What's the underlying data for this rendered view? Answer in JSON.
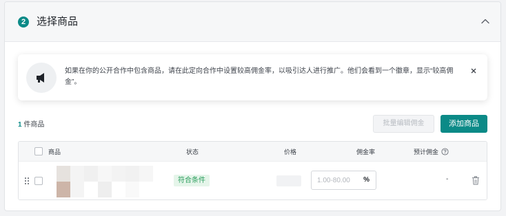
{
  "section": {
    "step_number": "2",
    "title": "选择商品",
    "collapse_icon": "chevron-up-icon"
  },
  "notice": {
    "icon": "megaphone-icon",
    "text": "如果在你的公开合作中包含商品，请在此定向合作中设置较高佣金率，以吸引达人进行推广。他们会看到一个徽章，显示“较高佣金”。",
    "close_icon": "close-icon"
  },
  "toolbar": {
    "count_number": "1",
    "count_suffix": " 件商品",
    "bulk_edit_label": "批量编辑佣金",
    "add_product_label": "添加商品"
  },
  "table": {
    "headers": {
      "product": "商品",
      "status": "状态",
      "price": "价格",
      "commission_rate": "佣金率",
      "estimated_commission": "预计佣金"
    },
    "rows": [
      {
        "status": "符合条件",
        "price": "",
        "rate_value": "",
        "rate_placeholder": "1.00-80.00",
        "rate_unit": "%",
        "estimated_commission": "-"
      }
    ]
  },
  "colors": {
    "accent": "#0b8a87",
    "status_green_bg": "#e5f5ea",
    "status_green_text": "#2a9d5c",
    "disabled_text": "#b8bcc2"
  }
}
